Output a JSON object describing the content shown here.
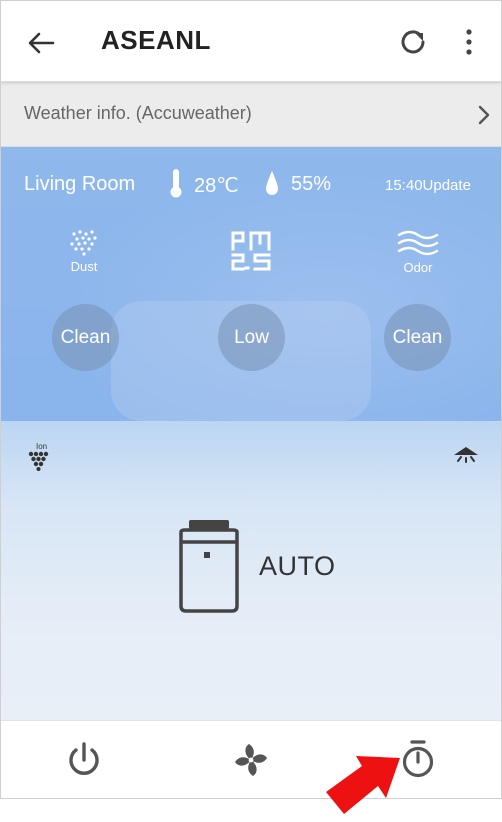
{
  "header": {
    "title": "ASEANL",
    "back_icon": "arrow-left-icon",
    "refresh_icon": "refresh-icon",
    "more_icon": "more-vertical-icon"
  },
  "weather": {
    "label": "Weather info. (Accuweather)",
    "chevron_icon": "chevron-right-icon"
  },
  "status": {
    "room": "Living Room",
    "temperature": "28℃",
    "humidity": "55%",
    "update": "15:40Update",
    "sensors": [
      {
        "icon": "dust-icon",
        "label": "Dust",
        "value": "Clean"
      },
      {
        "icon": "pm25-icon",
        "label": "",
        "value": "Low"
      },
      {
        "icon": "odor-icon",
        "label": "Odor",
        "value": "Clean"
      }
    ]
  },
  "controls": {
    "ion_icon": "ion-icon",
    "ion_text": "Ion",
    "swing_icon": "swing-icon",
    "device_icon": "air-purifier-icon",
    "mode": "AUTO"
  },
  "bottom_bar": {
    "power_icon": "power-icon",
    "fan_icon": "fan-icon",
    "timer_icon": "timer-icon"
  },
  "colors": {
    "panel_blue": "#8eb7ec",
    "bubble": "#7891b4",
    "icon_dark": "#444444",
    "annotation_arrow": "#ee1111"
  }
}
